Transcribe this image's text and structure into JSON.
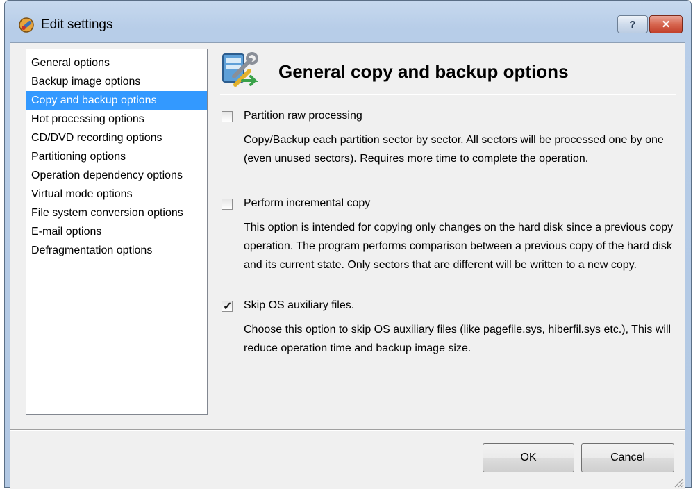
{
  "window": {
    "title": "Edit settings",
    "help_label": "?",
    "close_label": "✕"
  },
  "sidebar": {
    "items": [
      {
        "label": "General options"
      },
      {
        "label": "Backup image options"
      },
      {
        "label": "Copy and backup options",
        "selected": true
      },
      {
        "label": "Hot processing options"
      },
      {
        "label": "CD/DVD recording options"
      },
      {
        "label": "Partitioning options"
      },
      {
        "label": "Operation dependency options"
      },
      {
        "label": "Virtual mode options"
      },
      {
        "label": "File system conversion options"
      },
      {
        "label": "E-mail options"
      },
      {
        "label": "Defragmentation options"
      }
    ]
  },
  "main": {
    "title": "General copy and backup options",
    "options": [
      {
        "label": "Partition raw processing",
        "checked": false,
        "description": "Copy/Backup each partition sector by sector. All sectors will be processed one by one (even unused sectors). Requires more time to complete the operation."
      },
      {
        "label": "Perform incremental copy",
        "checked": false,
        "description": "This option is intended for copying only changes on the hard disk since a previous copy operation. The program performs comparison between a previous copy of the hard disk and its current state. Only sectors that are different will be written to a new copy."
      },
      {
        "label": "Skip OS auxiliary files.",
        "checked": true,
        "description": "Choose this option to skip OS auxiliary files (like pagefile.sys, hiberfil.sys etc.), This will reduce operation time and backup image size."
      }
    ]
  },
  "footer": {
    "ok_label": "OK",
    "cancel_label": "Cancel"
  },
  "colors": {
    "selection": "#3399ff",
    "frame": "#b7cde8",
    "close": "#d7664f"
  },
  "icons": [
    "settings-app-icon",
    "help-icon",
    "close-icon",
    "copy-backup-tools-icon",
    "checkbox-check-icon",
    "resize-grip-icon"
  ]
}
